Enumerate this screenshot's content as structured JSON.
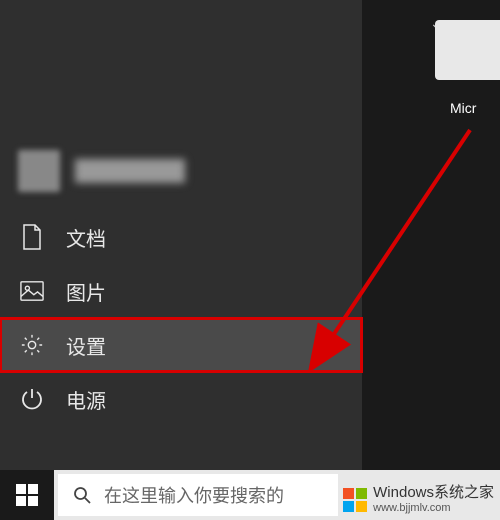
{
  "desktop": {
    "chevron": "⌄",
    "icon_label": "Micr"
  },
  "start_menu": {
    "items": [
      {
        "id": "documents",
        "label": "文档",
        "highlighted": false
      },
      {
        "id": "pictures",
        "label": "图片",
        "highlighted": false
      },
      {
        "id": "settings",
        "label": "设置",
        "highlighted": true
      },
      {
        "id": "power",
        "label": "电源",
        "highlighted": false
      }
    ]
  },
  "taskbar": {
    "search_placeholder": "在这里输入你要搜索的"
  },
  "watermark": {
    "title": "Windows系统之家",
    "url": "www.bjjmlv.com"
  },
  "annotation": {
    "arrow_color": "#d80000"
  }
}
